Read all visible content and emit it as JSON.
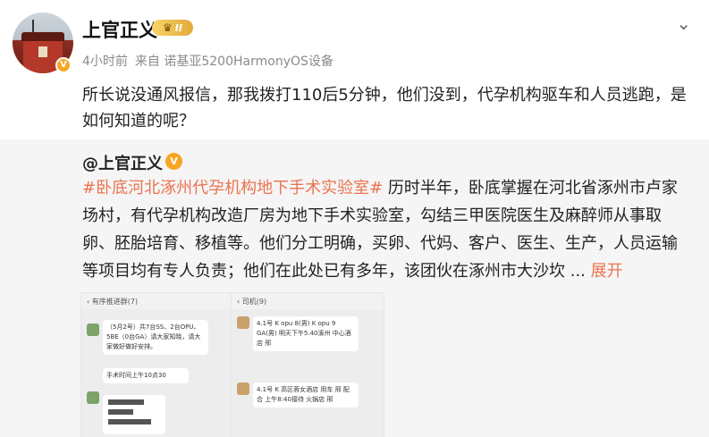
{
  "user": {
    "name": "上官正义",
    "level": "II",
    "time": "4小时前",
    "source": "来自 诺基亚5200HarmonyOS设备"
  },
  "post": {
    "text": "所长说没通风报信，那我拨打110后5分钟，他们没到，代孕机构驱车和人员逃跑，是如何知道的呢？"
  },
  "repost": {
    "author": "@上官正义",
    "topic": "#卧底河北涿州代孕机构地下手术实验室#",
    "body": " 历时半年，卧底掌握在河北省涿州市卢家场村，有代孕机构改造厂房为地下手术实验室，勾结三甲医院医生及麻醉师从事取卵、胚胎培育、移植等。他们分工明确，买卵、代妈、客户、医生、生产，人员运输等项目均有专人负责；他们在此处已有多年，该团伙在涿州市大沙坎 ...",
    "expand_label": "展开",
    "images": [
      {
        "title": "有序推进群(7)",
        "msg1": "（5月2号）共7台SS、2台OPU、5BE（0台GA）请大家知晓，请大家做好做好安排。",
        "msg2": "手术时间上午10点30"
      },
      {
        "title": "司机(9)",
        "msg1": "4.1号 K opu 8(男) K opu 9 GA(男) 明天下午5.40涿州 中心酒店 邢",
        "msg2": "4.1号 K 高区蓉女酒店 用车 邢 配合 上午8:40接待 火锅店 邢"
      }
    ]
  },
  "colors": {
    "topic": "#eb7350",
    "badge": "#f6a623"
  }
}
